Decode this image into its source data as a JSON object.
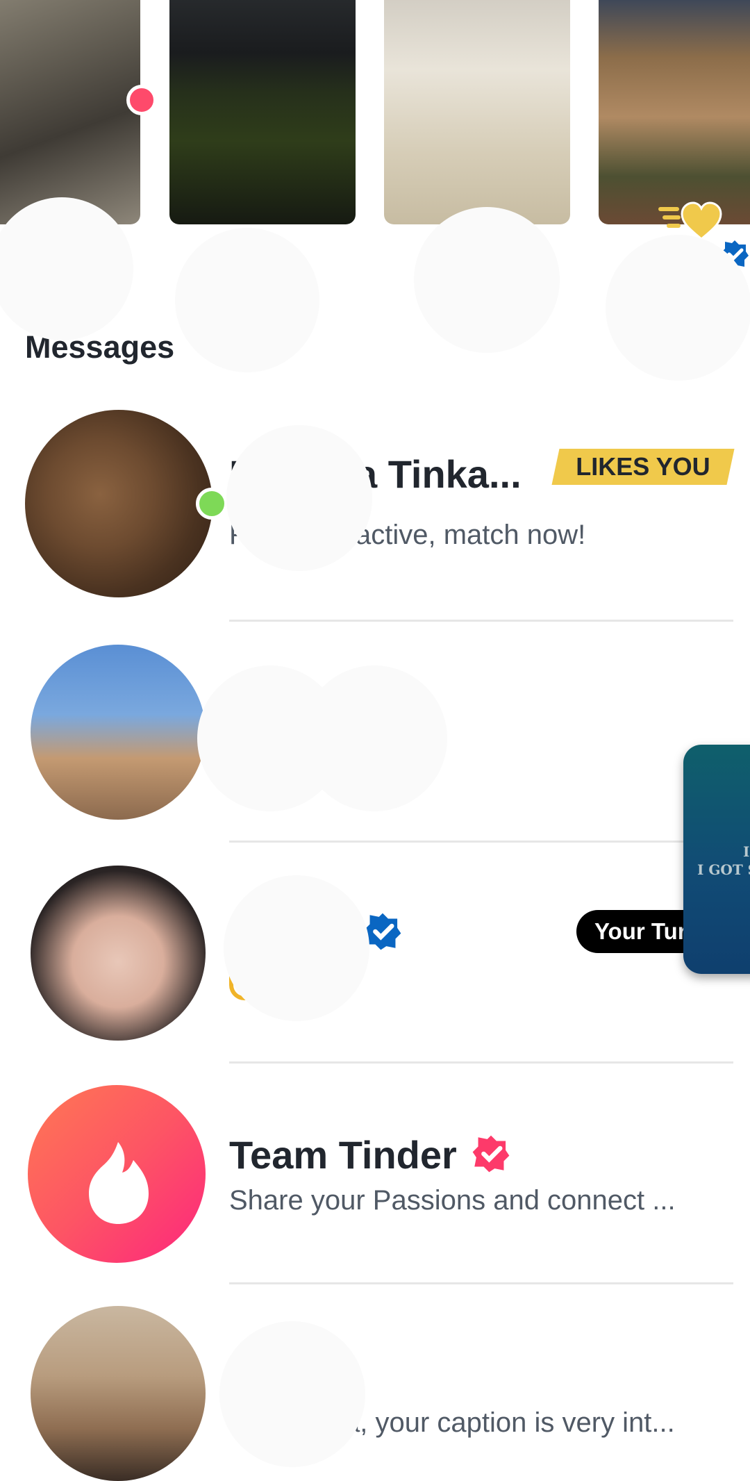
{
  "colors": {
    "accent": "#fd5564",
    "likes_badge": "#f0c94b",
    "online": "#7ed957",
    "verified_blue": "#0a66c2",
    "verified_red": "#fd3a6a",
    "divider": "#e6e6e6"
  },
  "matches": {
    "new_indicator_icon": "red-dot",
    "cards": [
      {
        "name": "",
        "photo": "woman-sitting-on-rocks"
      },
      {
        "name": "",
        "photo": "woman-on-lawn-at-night"
      },
      {
        "name": "",
        "photo": "woman-mirror-selfie"
      },
      {
        "name": "",
        "photo": "woman-at-balcony-city"
      }
    ],
    "super_like_icon": "gold-heart-icon"
  },
  "messages": {
    "title": "Messages",
    "items": [
      {
        "name": "a Tinka...",
        "preview": "active, match now!",
        "badge": "LIKES YOU",
        "online": true,
        "name_prefix": "F",
        "preview_prefix": "F"
      },
      {
        "name": "",
        "preview": ""
      },
      {
        "name": "",
        "preview": "",
        "status": "Your Tur",
        "verified": "blue-check-icon"
      },
      {
        "name": "Team Tinder",
        "preview": "Share your Passions and connect ...",
        "verified": "red-check-icon"
      },
      {
        "name": "",
        "preview": "a, your caption is very int..."
      }
    ]
  },
  "floating_card": {
    "text": "I GOT SO",
    "text_top": "I"
  }
}
